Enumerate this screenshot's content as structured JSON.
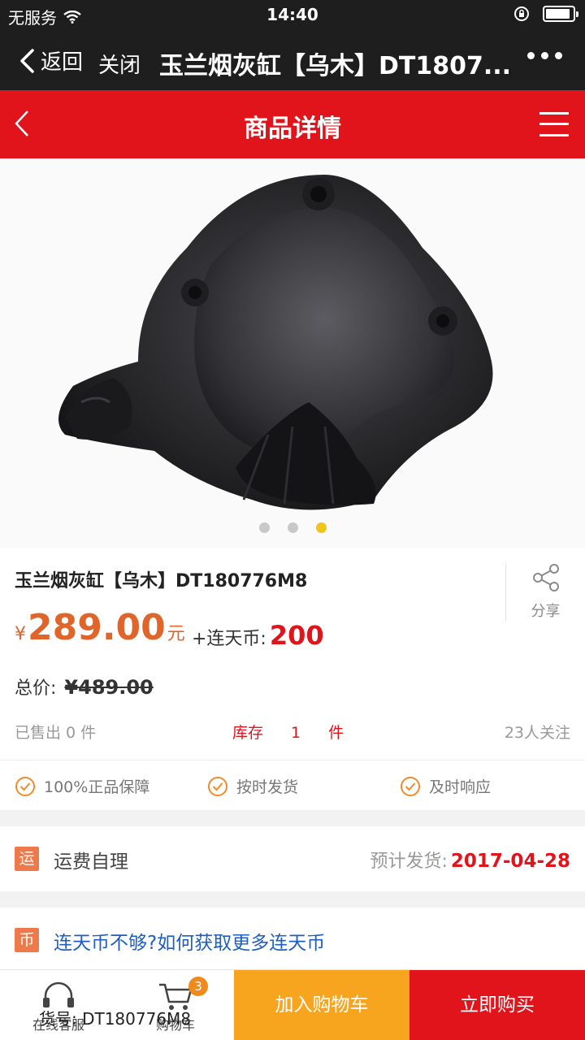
{
  "status_bar": {
    "carrier": "无服务",
    "time": "14:40",
    "battery_level": 0.9
  },
  "wechat_bar": {
    "back_label": "返回",
    "close_label": "关闭",
    "title": "玉兰烟灰缸【乌木】DT1807..."
  },
  "header": {
    "title": "商品详情"
  },
  "gallery": {
    "image_count": 3,
    "active_index": 2
  },
  "product": {
    "name": "玉兰烟灰缸【乌木】DT180776M8",
    "share_label": "分享",
    "price_symbol": "¥",
    "price": "289.00",
    "price_unit": "元",
    "coin_label": "+连天币:",
    "coin_amount": "200",
    "total_label": "总价:",
    "total_original": "¥489.00",
    "sold": "已售出 0 件",
    "stock_label": "库存",
    "stock_count": "1",
    "stock_unit": "件",
    "followers": "23人关注"
  },
  "guarantees": [
    "100%正品保障",
    "按时发货",
    "及时响应"
  ],
  "shipping": {
    "icon_char": "运",
    "label": "运费自理",
    "eta_label": "预计发货:",
    "eta_date": "2017-04-28"
  },
  "coin_help": {
    "icon_char": "币",
    "link": "连天币不够?如何获取更多连天币"
  },
  "bottom_bar": {
    "service_label": "在线客服",
    "cart_label": "购物车",
    "cart_badge": "3",
    "add_to_cart": "加入购物车",
    "buy_now": "立即购买",
    "sku_overlay": "货号:  DT180776M8"
  },
  "colors": {
    "brand_red": "#e1141c",
    "price_orange": "#e0652b",
    "cart_orange": "#f7a41e",
    "link_blue": "#1f5fbf"
  }
}
